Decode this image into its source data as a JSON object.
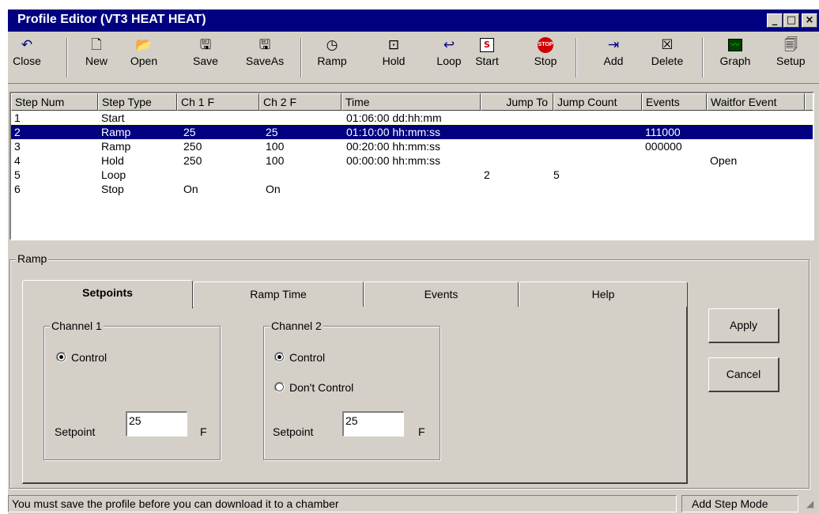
{
  "window": {
    "title": "Profile Editor (VT3 HEAT HEAT)",
    "controls": {
      "minimize": "_",
      "maximize": "□",
      "close": "×"
    }
  },
  "toolbar": {
    "buttons": [
      {
        "label": "Close",
        "icon": "undo-arrow-icon",
        "glyph": "↶"
      },
      {
        "label": "New",
        "icon": "new-document-icon",
        "glyph": "🗋"
      },
      {
        "label": "Open",
        "icon": "open-folder-icon",
        "glyph": "📂"
      },
      {
        "label": "Save",
        "icon": "floppy-disk-icon",
        "glyph": "🖫"
      },
      {
        "label": "SaveAs",
        "icon": "floppy-disk-icon",
        "glyph": "🖫"
      },
      {
        "label": "Ramp",
        "icon": "ramp-clock-icon",
        "glyph": "◷"
      },
      {
        "label": "Hold",
        "icon": "hold-icon",
        "glyph": "⊡"
      },
      {
        "label": "Loop",
        "icon": "loop-icon",
        "glyph": "↩"
      },
      {
        "label": "Start",
        "icon": "start-icon",
        "glyph": "S"
      },
      {
        "label": "Stop",
        "icon": "stop-sign-icon",
        "glyph": "STOP"
      },
      {
        "label": "Add",
        "icon": "add-step-icon",
        "glyph": "⇥"
      },
      {
        "label": "Delete",
        "icon": "delete-icon",
        "glyph": "☒"
      },
      {
        "label": "Graph",
        "icon": "graph-icon",
        "glyph": "〰"
      },
      {
        "label": "Setup",
        "icon": "setup-icon",
        "glyph": "🗐"
      }
    ]
  },
  "steps": {
    "columns": [
      "Step Num",
      "Step Type",
      "Ch 1 F",
      "Ch 2 F",
      "Time",
      "Jump To",
      "Jump Count",
      "Events",
      "Waitfor Event"
    ],
    "rows": [
      {
        "num": "1",
        "type": "Start",
        "ch1": "",
        "ch2": "",
        "time": "01:06:00 dd:hh:mm",
        "jump_to": "",
        "jump_count": "",
        "events": "",
        "waitfor": ""
      },
      {
        "num": "2",
        "type": "Ramp",
        "ch1": "25",
        "ch2": "25",
        "time": "01:10:00 hh:mm:ss",
        "jump_to": "",
        "jump_count": "",
        "events": "111000",
        "waitfor": ""
      },
      {
        "num": "3",
        "type": "Ramp",
        "ch1": "250",
        "ch2": "100",
        "time": "00:20:00 hh:mm:ss",
        "jump_to": "",
        "jump_count": "",
        "events": "000000",
        "waitfor": ""
      },
      {
        "num": "4",
        "type": "Hold",
        "ch1": "250",
        "ch2": "100",
        "time": "00:00:00 hh:mm:ss",
        "jump_to": "",
        "jump_count": "",
        "events": "",
        "waitfor": "Open"
      },
      {
        "num": "5",
        "type": "Loop",
        "ch1": "",
        "ch2": "",
        "time": "",
        "jump_to": "2",
        "jump_count": "5",
        "events": "",
        "waitfor": ""
      },
      {
        "num": "6",
        "type": "Stop",
        "ch1": "On",
        "ch2": "On",
        "time": "",
        "jump_to": "",
        "jump_count": "",
        "events": "",
        "waitfor": ""
      }
    ],
    "selected_row": "2"
  },
  "ramp": {
    "group_label": "Ramp",
    "tabs": [
      "Setpoints",
      "Ramp Time",
      "Events",
      "Help"
    ],
    "active_tab": "Setpoints",
    "channel1": {
      "label": "Channel 1",
      "control": "Control",
      "setpoint_label": "Setpoint",
      "setpoint_value": "25",
      "unit": "F"
    },
    "channel2": {
      "label": "Channel 2",
      "control": "Control",
      "dont_control": "Don't Control",
      "setpoint_label": "Setpoint",
      "setpoint_value": "25",
      "unit": "F"
    },
    "apply_label": "Apply",
    "cancel_label": "Cancel"
  },
  "status": {
    "message": "You must save the profile before you can download it to a chamber",
    "mode": "Add Step Mode"
  },
  "colors": {
    "titlebar": "#000080",
    "face": "#d4d0c8",
    "selection": "#000080"
  }
}
